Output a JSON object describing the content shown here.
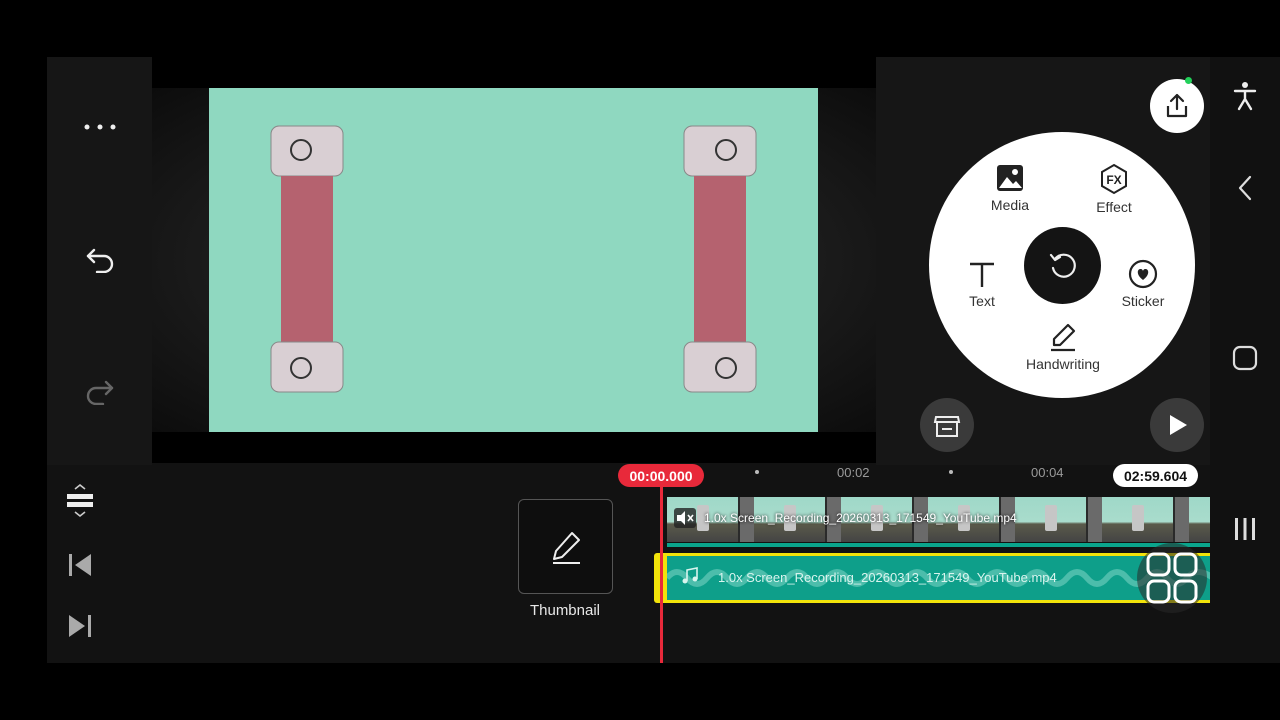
{
  "colors": {
    "accent_red": "#e8293a",
    "audio_track": "#0e9f8a",
    "audio_border": "#f2e30a",
    "video_bg": "#8fd8c0"
  },
  "left_toolbar": {
    "more_icon": "more-horizontal-icon",
    "undo_icon": "undo-icon",
    "redo_icon": "redo-icon"
  },
  "right_panel": {
    "export_icon": "share-export-icon",
    "wheel": {
      "media_label": "Media",
      "effect_label": "Effect",
      "text_label": "Text",
      "sticker_label": "Sticker",
      "handwriting_label": "Handwriting",
      "center_icon": "rotate-icon"
    },
    "store_icon": "store-icon",
    "play_icon": "play-icon"
  },
  "timeline": {
    "current_time": "00:00.000",
    "total_time": "02:59.604",
    "tick_labels": [
      "00:02",
      "00:04"
    ],
    "thumbnail_label": "Thumbnail",
    "video_clip_label": "1.0x Screen_Recording_20260313_171549_YouTube.mp4",
    "audio_clip_label": "1.0x Screen_Recording_20260313_171549_YouTube.mp4"
  },
  "system_nav": {
    "accessibility_icon": "accessibility-icon",
    "back_icon": "back-chevron-icon",
    "home_icon": "home-icon",
    "recents_icon": "recents-icon"
  }
}
